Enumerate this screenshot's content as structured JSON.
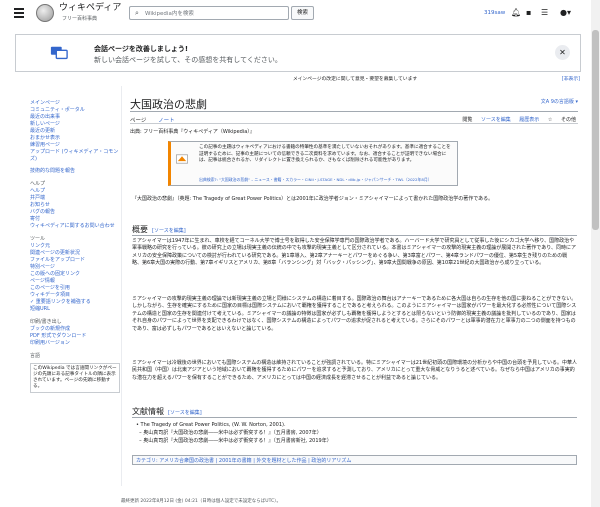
{
  "header": {
    "logo_title": "ウィキペディア",
    "logo_subtitle": "フリー百科事典",
    "search_placeholder": "Wikipedia内を検索",
    "search_button": "検索",
    "username": "319saw"
  },
  "notice": {
    "title": "会話ページを改善しましょう!",
    "body": "新しい会話ページを試して、その感想を共有してください。"
  },
  "sitenotice": {
    "text": "メインページの改定に関して意見・要望を募集しています",
    "hide": "[非表示]"
  },
  "sidebar": {
    "main": [
      "メインページ",
      "コミュニティ・ポータル",
      "最近の出来事",
      "新しいページ",
      "最近の更新",
      "おまかせ表示",
      "練習用ページ",
      "アップロード (ウィキメディア・コモンズ)"
    ],
    "special": [
      "技術的な問題を報告"
    ],
    "help_heading": "ヘルプ",
    "help": [
      "ヘルプ",
      "井戸端",
      "お知らせ",
      "バグの報告",
      "寄付",
      "ウィキペディアに関するお問い合わせ"
    ],
    "tools_heading": "ツール",
    "tools": [
      "リンク元",
      "関連ページの更新状況",
      "ファイルをアップロード",
      "特別ページ",
      "この版への固定リンク",
      "ページ情報",
      "このページを引用",
      "ウィキデータ項目",
      "✓ 重要語リンクを補強する",
      "短縮URL"
    ],
    "print_heading": "印刷/書き出し",
    "print": [
      "ブックの新規作成",
      "PDF 形式でダウンロード",
      "印刷用バージョン"
    ],
    "lang_heading": "言語",
    "lang_box": "このWikipedia では言語間リンクがページの先頭にある記事タイトルの隣に表示されています。ページの先頭に移動する。"
  },
  "article": {
    "title": "大国政治の悲劇",
    "languages": "9の言語版",
    "tabs": [
      "ページ",
      "ノート"
    ],
    "right_tabs": [
      "閲覧",
      "ソースを編集",
      "履歴表示",
      "☆",
      "その他"
    ],
    "from": "出典: フリー百科事典『ウィキペディア（Wikipedia）』",
    "ambox_text": "この記事の主題はウィキペディアにおける書籍の特筆性の基準を満たしていないおそれがあります。基準に適合することを証明するために、記事の主題についての信頼できる二次資料を求めています。なお、適合することが証明できない場合には、記事は統合されるか、リダイレクトに置き換えられるか、さもなくば削除される可能性があります。",
    "ambox_source": "出典検索?: \"大国政治の悲劇\" – ニュース・書籍・スカラー・CiNii・J-STAGE・NDL・dlib.jp・ジャパンサーチ・TWL（2022年8月）",
    "lead": "『大国政治の悲劇』（英題: The Tragedy of Great Power Politics）とは2001年に政治学者ジョン・ミアシャイマーによって書かれた国際政治学の著作である。",
    "overview_heading": "概要",
    "edit_link": "[ソースを編集]",
    "p1": "ミアシャイマーは1947年に生まれ、車校を経てコーネル大学で博士号を取得した安全保障学専門の国際政治学者である。ハーバード大学で研究員として従事した後にシカゴ大学へ移り、国際政治や軍事戦略の研究を行っている。彼の研究上の立場は現実主義の伝統の中でも攻撃的現実主義として区分されている。本書はミアシャイマーの攻撃的現実主義の理論が展開された著作であり、同時にアメリカの安全保障政策についての検討が行われている研究である。第1章導入、第2章アナーキーとパワーをめぐる争い、第3章富とパワー、第4章ランドパワーの優位、第5章生き残りのための戦略、第6章大国の実際の行動、第7章イギリスとアメリカ、第8章「バランシング」対「バック・パッシング」、第9章大国間戦争の原因、第10章21世紀の大国政治から成り立っている。",
    "p2": "ミアシャイマーの攻撃的現実主義の理論では新現実主義の立場と同様にシステムの構造に着目する。国際政治の舞台はアナーキーであるために各大国は自らの生存を他の国に委ねることができない。しかしながら、生存を確実にするために国家の目標は国際システムにおいて覇権を獲得することであると考えられる。このようにミアシャイマーは国家がパワーを最大化する必然性について国際システムの構造と国家の生存を関連付けて考えている。ミアシャイマーの議論の特徴は国家が必ずしも覇権を獲得しようとするとは限らないという防御的現実主義の議論を批判しているのであり、国家はそれ自身のパワーによって世界を支配できるわけではなく、国際システムの構造によってパワーの追求が促されると考えている。さらにそのパワーとは軍事的潜在力と軍事力の二つの側面を持つものであり、富は必ずしもパワーであるとはいえないと論じている。",
    "p3": "ミアシャイマーは冷戦後の世界においても国際システムの構造は維持されていることが強調されている。特にミアシャイマーは21世紀初頭の国際環境の分析からや中国の台頭を予見している。中華人民共和国（中国）は北東アジアという地域において覇権を獲得するためにパワーを追求すると予測しており、アメリカにとって重大な脅威となりうると述べている。なぜなら中国はアメリカの事実的な潜在力を超えるパワーを保有することができるため、アメリカにとっては中国の経済成長を遅滞させることが利益であると論じている。",
    "refs_heading": "文献情報",
    "refs": [
      "The Tragedy of Great Power Politics, (W. W. Norton, 2001).",
      "奥山真司訳『大国政治の悲劇――米中は必ず衝突する！』（五月書房, 2007年）",
      "奥山真司訳『大国政治の悲劇――米中は必ず衝突する！』（五月書房新社, 2019年）"
    ],
    "categories": "カテゴリ: アメリカ合衆国の政治書 | 2001年の書籍 | 外交を題材とした作品 | 政治的リアリズム"
  },
  "footer": {
    "text": "最終更新 2022年8月12日 (金) 04:21（日時は個人設定で未設定ならばUTC）。"
  }
}
